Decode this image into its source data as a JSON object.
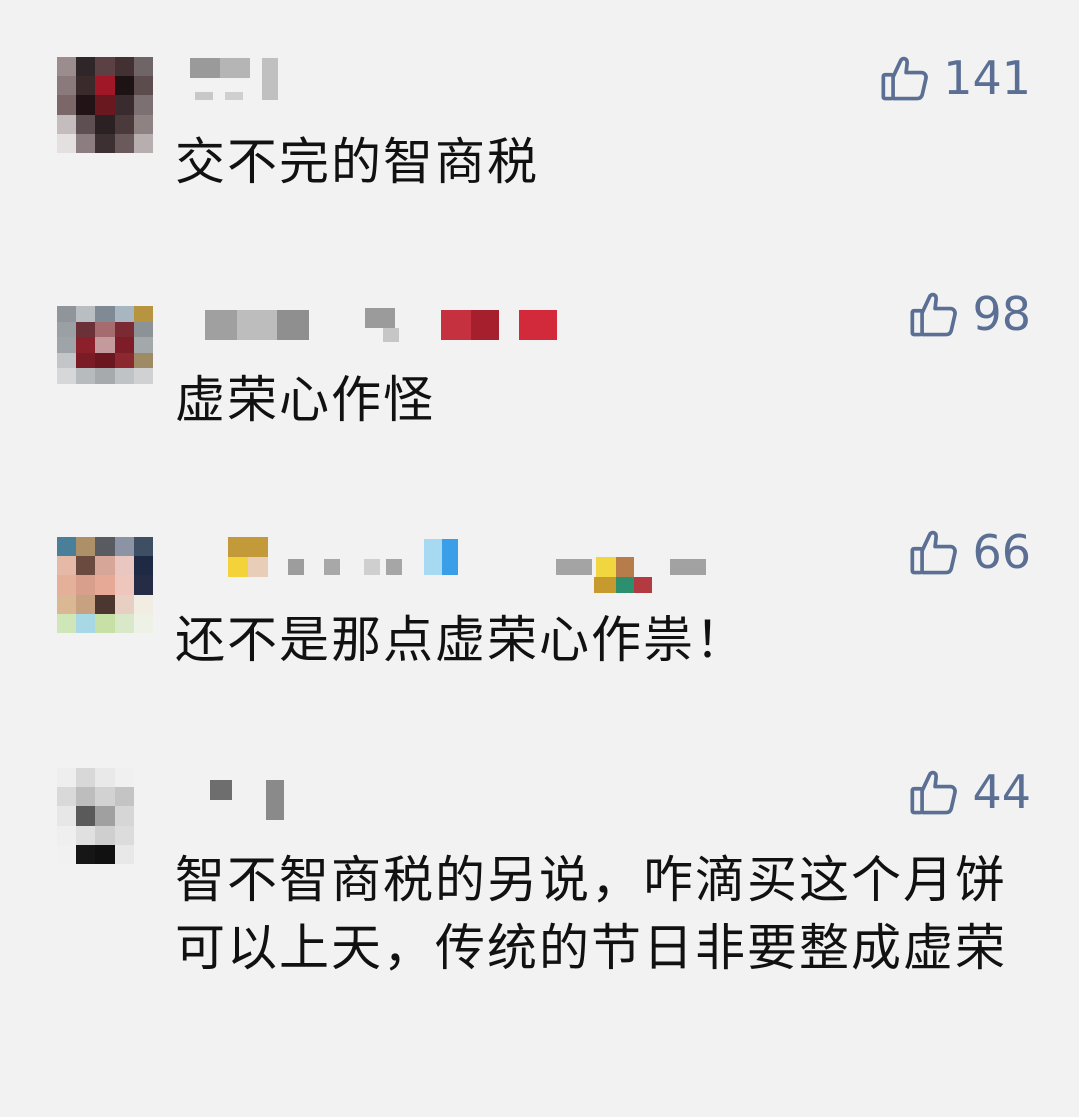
{
  "comments": [
    {
      "likes": "141",
      "text": "交不完的智商税",
      "avatar_colors": [
        "#9b8c8e",
        "#2e2628",
        "#5b4144",
        "#433033",
        "#6f6466",
        "#8a7a7c",
        "#3b2a2c",
        "#a01828",
        "#1e1314",
        "#5c4c4e",
        "#7b6668",
        "#221416",
        "#6a1820",
        "#3a2c2e",
        "#7d7072",
        "#c4bcbd",
        "#5e5052",
        "#2b2022",
        "#4a3a3c",
        "#8e8283",
        "#e4e0e0",
        "#8c7e80",
        "#3c3032",
        "#6a5a5c",
        "#b7aeaf"
      ]
    },
    {
      "likes": "98",
      "text": "虚荣心作怪",
      "avatar_colors": [
        "#8f959a",
        "#b9bec2",
        "#7f8a94",
        "#a8b6c1",
        "#b7943f",
        "#9aa0a4",
        "#6a3238",
        "#a56b6f",
        "#7b2a33",
        "#8d9296",
        "#9fa4a8",
        "#8b1f2a",
        "#c49a9c",
        "#7e1c27",
        "#a3a8ab",
        "#c3c6c9",
        "#7a1b26",
        "#6c1720",
        "#8c2830",
        "#9e8a64",
        "#d5d7d8",
        "#b8bbbd",
        "#a7aaac",
        "#c0c3c5",
        "#cfd1d2"
      ]
    },
    {
      "likes": "66",
      "text": "还不是那点虚荣心作祟！",
      "avatar_colors": [
        "#4a7f9a",
        "#ad9068",
        "#585b60",
        "#8c93a4",
        "#3f4f63",
        "#e6b8a8",
        "#6a4a3e",
        "#d6a698",
        "#e9c7c0",
        "#1e2a44",
        "#e4b09a",
        "#d89f8c",
        "#e5a995",
        "#efc6bb",
        "#242c46",
        "#dbb894",
        "#c8a280",
        "#4c3630",
        "#e8cfc4",
        "#f2ede2",
        "#cfe6b8",
        "#a8d8e6",
        "#c6e0a6",
        "#d9e8c8",
        "#eef2e6"
      ]
    },
    {
      "likes": "44",
      "text": "智不智商税的另说，咋滴买这个月饼可以上天，传统的节日非要整成虚荣",
      "avatar_colors": [
        "#eeeeee",
        "#d8d8d8",
        "#e9e9e9",
        "#f0f0f0",
        "#f2f2f2",
        "#d9d9d9",
        "#bdbdbd",
        "#d2d2d2",
        "#c4c4c4",
        "#f2f2f2",
        "#e7e7e7",
        "#5a5a5a",
        "#a0a0a0",
        "#d6d6d6",
        "#f2f2f2",
        "#efefef",
        "#e0e0e0",
        "#cfcfcf",
        "#dcdcdc",
        "#f2f2f2",
        "#f1f1f1",
        "#161616",
        "#111111",
        "#e8e8e8",
        "#f2f2f2"
      ]
    }
  ],
  "icons": {
    "like": "thumbs-up-icon"
  },
  "colors": {
    "like": "#5a6f93",
    "text": "#111111",
    "background": "#f2f2f2"
  }
}
